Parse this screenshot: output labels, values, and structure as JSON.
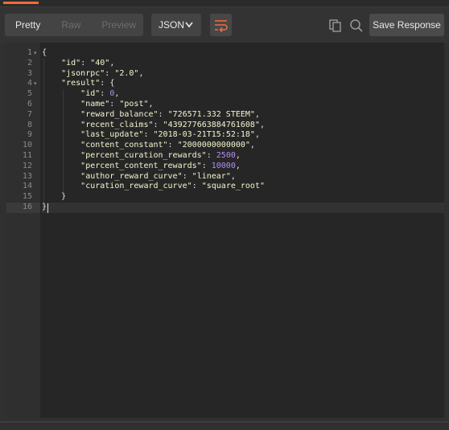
{
  "toolbar": {
    "pretty": "Pretty",
    "raw": "Raw",
    "preview": "Preview",
    "format": "JSON",
    "save": "Save Response"
  },
  "editor": {
    "line_numbers": [
      "1",
      "2",
      "3",
      "4",
      "5",
      "6",
      "7",
      "8",
      "9",
      "10",
      "11",
      "12",
      "13",
      "14",
      "15",
      "16"
    ],
    "lines": [
      "{",
      "    \"id\": \"40\",",
      "    \"jsonrpc\": \"2.0\",",
      "    \"result\": {",
      "        \"id\": 0,",
      "        \"name\": \"post\",",
      "        \"reward_balance\": \"726571.332 STEEM\",",
      "        \"recent_claims\": \"439277663884761608\",",
      "        \"last_update\": \"2018-03-21T15:52:18\",",
      "        \"content_constant\": \"2000000000000\",",
      "        \"percent_curation_rewards\": 2500,",
      "        \"percent_content_rewards\": 10000,",
      "        \"author_reward_curve\": \"linear\",",
      "        \"curation_reward_curve\": \"square_root\"",
      "    }",
      "}"
    ]
  },
  "colors": {
    "accent": "#f26b3a",
    "number": "#b58cf5",
    "string": "#f5f5d0"
  }
}
